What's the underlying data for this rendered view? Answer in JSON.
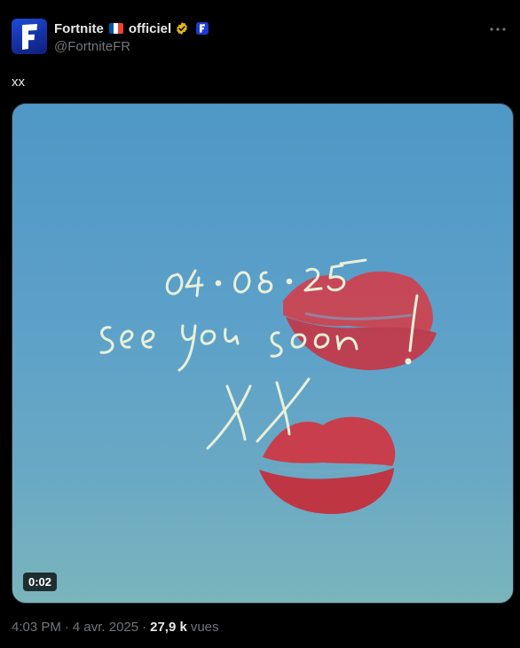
{
  "account": {
    "display_name": "Fortnite",
    "display_name_suffix": "officiel",
    "handle": "@FortniteFR",
    "avatar_letter": "F",
    "flag_colors": [
      "#0055a4",
      "#ffffff",
      "#ef4135"
    ]
  },
  "icons": {
    "verified": "verified-gold-badge",
    "affiliate": "fortnite-affiliate-badge",
    "more": "more-horizontal-icon"
  },
  "tweet": {
    "text": "xx",
    "video_duration": "0:02",
    "artwork_text": "04·08·25 see you soon! XX"
  },
  "meta": {
    "time": "4:03 PM",
    "separator1": "·",
    "date": "4 avr. 2025",
    "separator2": "·",
    "views_count": "27,9 k",
    "views_label": "vues"
  },
  "colors": {
    "background": "#000000",
    "text_primary": "#e7e9ea",
    "text_secondary": "#71767b",
    "verified_gold": "#e2b719"
  }
}
